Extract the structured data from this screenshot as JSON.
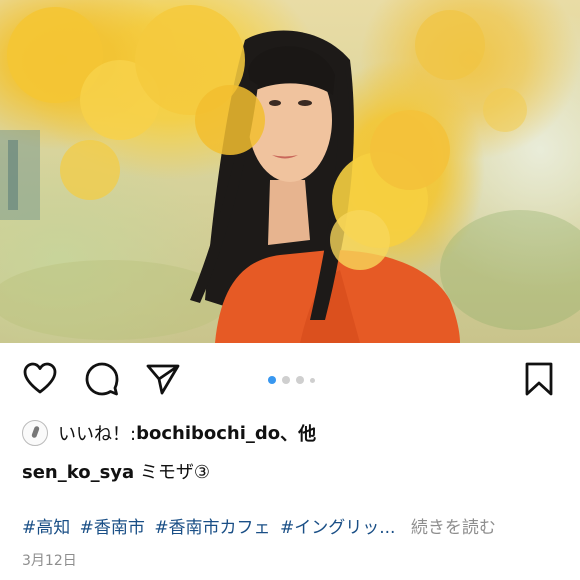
{
  "post": {
    "image_alt": "Woman in orange top among yellow mimosa flowers",
    "carousel": {
      "total": 4,
      "active_index": 0
    },
    "actions": {
      "like_icon": "heart-icon",
      "comment_icon": "comment-icon",
      "share_icon": "send-icon",
      "save_icon": "bookmark-icon"
    },
    "likes": {
      "prefix": "いいね！: ",
      "user": "bochibochi_do",
      "suffix": "、他"
    },
    "caption": {
      "username": "sen_ko_sya",
      "text": "ミモザ③"
    },
    "hashtags": [
      "#高知",
      "#香南市",
      "#香南市カフェ",
      "#イングリッ..."
    ],
    "more_label": "続きを読む",
    "date": "3月12日"
  },
  "colors": {
    "link": "#1a4f86",
    "muted": "#8e8e8e",
    "dot_active": "#3897f0",
    "dot_inactive": "#cfcfcf"
  }
}
